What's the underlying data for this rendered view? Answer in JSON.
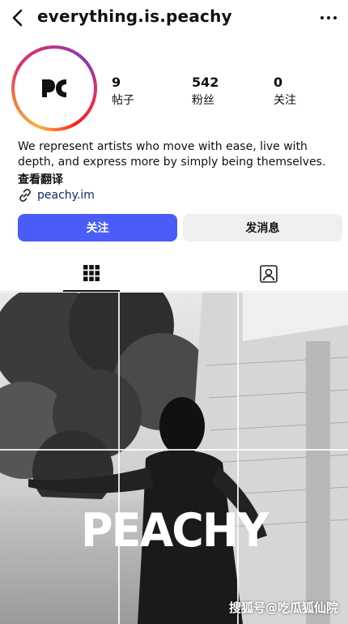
{
  "header": {
    "username": "everything.is.peachy"
  },
  "profile": {
    "avatar_text": "PC",
    "stats": [
      {
        "value": "9",
        "label": "帖子"
      },
      {
        "value": "542",
        "label": "粉丝"
      },
      {
        "value": "0",
        "label": "关注"
      }
    ],
    "bio": "We represent artists who move with ease, live with depth, and express more by simply being themselves.",
    "translate": "查看翻译",
    "link": "peachy.im"
  },
  "actions": {
    "follow": "关注",
    "message": "发消息"
  },
  "tabs": {
    "grid": "posts-grid",
    "tagged": "tagged"
  },
  "post": {
    "overlay_text": "PEACHY",
    "watermark": "搜狐号@吃瓜狐仙院"
  }
}
